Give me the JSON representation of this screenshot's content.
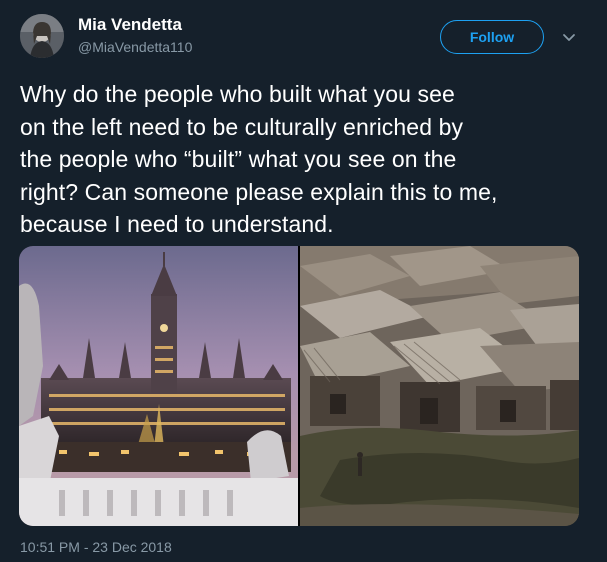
{
  "author": {
    "display_name": "Mia Vendetta",
    "handle": "@MiaVendetta110"
  },
  "actions": {
    "follow_label": "Follow",
    "more_icon": "chevron-down-icon"
  },
  "tweet": {
    "lines": [
      "Why do the people who built what you see",
      "on the left need to be culturally enriched by",
      "the people who “built” what you see on the",
      "right? Can someone please explain this to me,",
      "because I need to understand."
    ],
    "timestamp": "10:51 PM - 23 Dec 2018"
  },
  "colors": {
    "background": "#15202b",
    "accent": "#1da1f2",
    "secondary_text": "#8899a6"
  }
}
